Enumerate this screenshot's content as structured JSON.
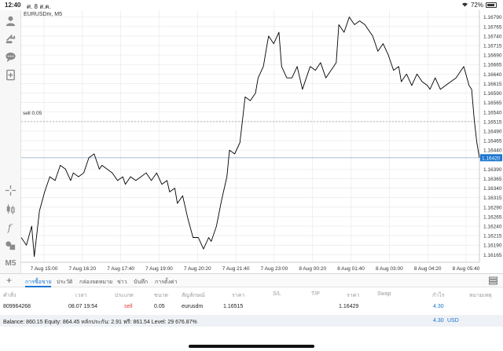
{
  "status": {
    "time": "12:40",
    "date": "ศ. 8 ส.ค.",
    "battery": "72%",
    "battery_level": 0.72
  },
  "chart": {
    "symbol": "EURUSDm, M5",
    "order_line_label": "sell 0.05",
    "order_price": 1.16515,
    "current_price_label": "1.16420",
    "current_price": 1.1642,
    "ylim": [
      1.16145,
      1.16808
    ],
    "y_ticks": [
      "1.16790",
      "1.16765",
      "1.16740",
      "1.16715",
      "1.16690",
      "1.16665",
      "1.16640",
      "1.16615",
      "1.16590",
      "1.16565",
      "1.16540",
      "1.16515",
      "1.16490",
      "1.16465",
      "1.16440",
      "1.16390",
      "1.16365",
      "1.16340",
      "1.16315",
      "1.16290",
      "1.16265",
      "1.16240",
      "1.16215",
      "1.16190",
      "1.16165"
    ],
    "y_tick_values": [
      1.1679,
      1.16765,
      1.1674,
      1.16715,
      1.1669,
      1.16665,
      1.1664,
      1.16615,
      1.1659,
      1.16565,
      1.1654,
      1.16515,
      1.1649,
      1.16465,
      1.1644,
      1.1639,
      1.16365,
      1.1634,
      1.16315,
      1.1629,
      1.16265,
      1.1624,
      1.16215,
      1.1619,
      1.16165
    ],
    "x_ticks": [
      "7 Aug 15:00",
      "7 Aug 16:20",
      "7 Aug 17:40",
      "7 Aug 19:00",
      "7 Aug 20:20",
      "7 Aug 21:40",
      "7 Aug 23:00",
      "8 Aug 00:20",
      "8 Aug 01:40",
      "8 Aug 03:00",
      "8 Aug 04:20",
      "8 Aug 05:40"
    ],
    "colors": {
      "line": "#000000",
      "grid": "#e6e6e6",
      "order": "#9a9a9a",
      "price_line": "#8aa7c4",
      "price_tag": "#1b75d0"
    }
  },
  "chart_data": {
    "type": "line",
    "title": "EURUSDm, M5",
    "x_start": "7 Aug 15:00",
    "x_end": "8 Aug 05:40",
    "x_unit": "5-minute bar index",
    "xlim": [
      0,
      176
    ],
    "ylim": [
      1.16145,
      1.16808
    ],
    "grid": true,
    "series": [
      {
        "values": [
          [
            0,
            1.1621
          ],
          [
            2,
            1.1619
          ],
          [
            4,
            1.1624
          ],
          [
            5,
            1.1616
          ],
          [
            7,
            1.1628
          ],
          [
            9,
            1.1633
          ],
          [
            11,
            1.1637
          ],
          [
            13,
            1.1636
          ],
          [
            15,
            1.164
          ],
          [
            17,
            1.1639
          ],
          [
            19,
            1.1636
          ],
          [
            20,
            1.1638
          ],
          [
            22,
            1.1637
          ],
          [
            24,
            1.1638
          ],
          [
            26,
            1.1642
          ],
          [
            28,
            1.1643
          ],
          [
            30,
            1.1639
          ],
          [
            31,
            1.164
          ],
          [
            33,
            1.1639
          ],
          [
            35,
            1.1638
          ],
          [
            37,
            1.1636
          ],
          [
            39,
            1.1637
          ],
          [
            40,
            1.1635
          ],
          [
            42,
            1.1637
          ],
          [
            44,
            1.1636
          ],
          [
            46,
            1.1637
          ],
          [
            48,
            1.1638
          ],
          [
            50,
            1.1636
          ],
          [
            52,
            1.1638
          ],
          [
            54,
            1.1635
          ],
          [
            56,
            1.1636
          ],
          [
            57,
            1.1633
          ],
          [
            59,
            1.1634
          ],
          [
            60,
            1.163
          ],
          [
            62,
            1.1632
          ],
          [
            64,
            1.1626
          ],
          [
            66,
            1.1621
          ],
          [
            68,
            1.1621
          ],
          [
            70,
            1.1618
          ],
          [
            72,
            1.1621
          ],
          [
            73,
            1.162
          ],
          [
            75,
            1.1624
          ],
          [
            77,
            1.1631
          ],
          [
            79,
            1.1637
          ],
          [
            80,
            1.1644
          ],
          [
            82,
            1.1643
          ],
          [
            84,
            1.1646
          ],
          [
            86,
            1.1658
          ],
          [
            88,
            1.1657
          ],
          [
            90,
            1.1659
          ],
          [
            91,
            1.1663
          ],
          [
            93,
            1.1666
          ],
          [
            95,
            1.1674
          ],
          [
            97,
            1.1672
          ],
          [
            99,
            1.1675
          ],
          [
            100,
            1.1666
          ],
          [
            102,
            1.1663
          ],
          [
            104,
            1.1663
          ],
          [
            106,
            1.1666
          ],
          [
            108,
            1.166
          ],
          [
            110,
            1.1664
          ],
          [
            111,
            1.1666
          ],
          [
            113,
            1.1665
          ],
          [
            115,
            1.1667
          ],
          [
            117,
            1.1663
          ],
          [
            119,
            1.1665
          ],
          [
            121,
            1.1667
          ],
          [
            122,
            1.1677
          ],
          [
            124,
            1.1675
          ],
          [
            126,
            1.1679
          ],
          [
            128,
            1.1677
          ],
          [
            130,
            1.1678
          ],
          [
            132,
            1.1677
          ],
          [
            134,
            1.1675
          ],
          [
            135,
            1.1674
          ],
          [
            137,
            1.167
          ],
          [
            139,
            1.1672
          ],
          [
            141,
            1.1669
          ],
          [
            143,
            1.1665
          ],
          [
            145,
            1.1666
          ],
          [
            146,
            1.1662
          ],
          [
            148,
            1.1664
          ],
          [
            150,
            1.1661
          ],
          [
            152,
            1.1664
          ],
          [
            154,
            1.1662
          ],
          [
            156,
            1.1661
          ],
          [
            157,
            1.166
          ],
          [
            159,
            1.1663
          ],
          [
            161,
            1.166
          ],
          [
            163,
            1.1661
          ],
          [
            165,
            1.1662
          ],
          [
            167,
            1.1663
          ],
          [
            169,
            1.1665
          ],
          [
            170,
            1.1666
          ],
          [
            172,
            1.1661
          ],
          [
            173,
            1.166
          ],
          [
            174,
            1.1652
          ],
          [
            175,
            1.1646
          ],
          [
            176,
            1.1642
          ]
        ]
      }
    ]
  },
  "toolbar": {
    "icons": [
      "account-icon",
      "trade-icon",
      "chat-icon",
      "new-order-icon",
      "crosshair-icon",
      "candles-icon",
      "indicator-icon",
      "objects-icon"
    ],
    "timeframe": "M5"
  },
  "tabs": [
    "การซื้อขาย",
    "ประวัติ",
    "กล่องจดหมาย",
    "ข่าว",
    "บันทึก",
    "การตั้งค่า"
  ],
  "table": {
    "headers": [
      "คำสั่ง",
      "เวลา",
      "ประเภท",
      "ขนาด",
      "สัญลักษณ์",
      "ราคา",
      "S/L",
      "T/P",
      "ราคา",
      "Swap",
      "กำไร",
      "หมายเหตุ"
    ],
    "row": {
      "ticket": "809964268",
      "time": "08.07 19:54",
      "type": "sell",
      "volume": "0.05",
      "symbol": "eurusdm",
      "open_price": "1.16515",
      "sl": "",
      "tp": "",
      "price": "1.16429",
      "swap": "",
      "profit": "4.30",
      "comment": ""
    }
  },
  "balance": {
    "summary": "Balance: 860.15 Equity: 864.45 หลักประกัน: 2.91 ฟรี: 861.54 Level: 29 676.87%",
    "total": "4.30",
    "currency": "USD"
  }
}
